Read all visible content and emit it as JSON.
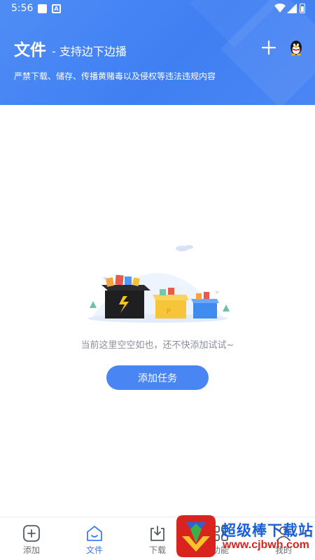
{
  "status_bar": {
    "time": "5:56"
  },
  "header": {
    "title": "文件",
    "subtitle": "- 支持边下边播",
    "warning": "严禁下载、储存、传播黄赌毒以及侵权等违法违规内容"
  },
  "empty_state": {
    "message": "当前这里空空如也，还不快添加试试~",
    "button_label": "添加任务"
  },
  "bottom_nav": {
    "items": [
      {
        "label": "添加",
        "icon": "add-square-icon"
      },
      {
        "label": "文件",
        "icon": "home-icon"
      },
      {
        "label": "下载",
        "icon": "download-icon"
      },
      {
        "label": "功能",
        "icon": "functions-icon"
      },
      {
        "label": "我的",
        "icon": "profile-icon"
      }
    ]
  },
  "watermark": {
    "text": "超级棒下载站",
    "url": "www.cjbwh.com"
  },
  "colors": {
    "accent": "#3d7cf2",
    "header": "#4a86f4"
  }
}
